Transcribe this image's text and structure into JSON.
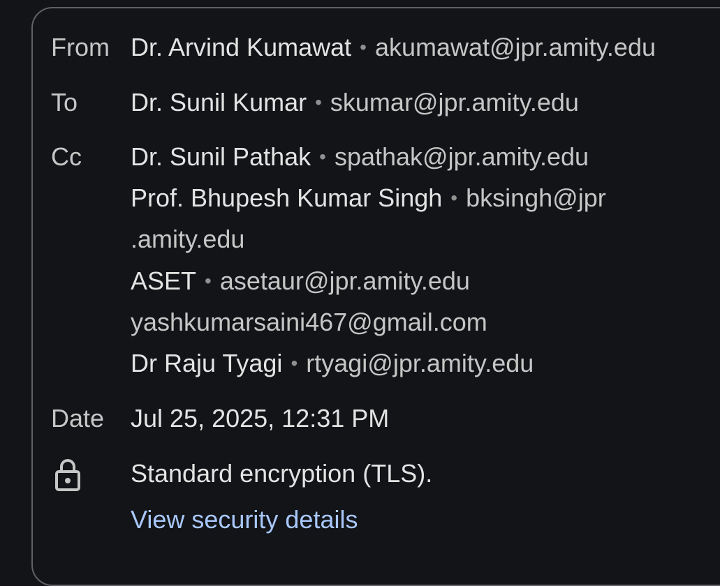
{
  "header": {
    "from_label": "From",
    "from": {
      "name": "Dr. Arvind Kumawat",
      "email": "akumawat@jpr.amity.edu"
    },
    "to_label": "To",
    "to": {
      "name": "Dr. Sunil Kumar",
      "email": "skumar@jpr.amity.edu"
    },
    "cc_label": "Cc",
    "cc": [
      {
        "name": "Dr. Sunil Pathak",
        "email": "spathak@jpr.amity.edu"
      },
      {
        "name": "Prof. Bhupesh Kumar Singh",
        "email_part1": "bksingh@jpr",
        "email_part2": ".amity.edu"
      },
      {
        "name": "ASET",
        "email": "asetaur@jpr.amity.edu"
      },
      {
        "email": "yashkumarsaini467@gmail.com"
      },
      {
        "name": "Dr Raju Tyagi",
        "email": "rtyagi@jpr.amity.edu"
      }
    ],
    "date_label": "Date",
    "date": "Jul 25, 2025, 12:31 PM",
    "security_icon": "lock-icon",
    "security_text": "Standard encryption (TLS).",
    "security_link": "View security details",
    "separator": "•"
  },
  "colors": {
    "background": "#131418",
    "border": "#5f6164",
    "label": "#c4c7c5",
    "name": "#e3e3e3",
    "link": "#a8c7fa"
  }
}
